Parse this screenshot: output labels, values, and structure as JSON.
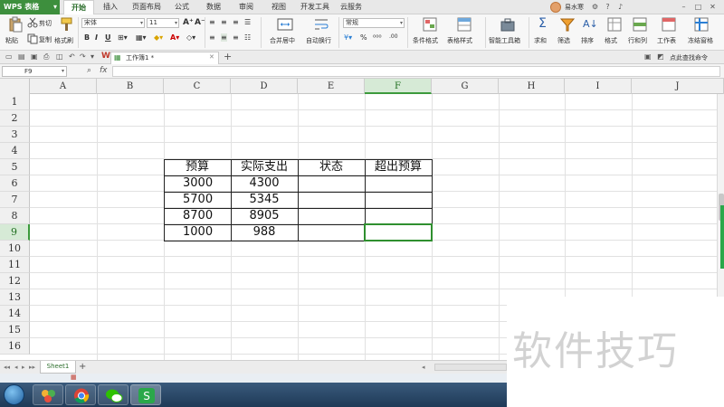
{
  "menubar": {
    "app_label": "WPS 表格",
    "tabs": [
      "开始",
      "插入",
      "页面布局",
      "公式",
      "数据",
      "审阅",
      "视图",
      "开发工具",
      "云服务"
    ],
    "active_tab": "开始",
    "user_name": "易水寒"
  },
  "ribbon": {
    "cut": "剪切",
    "paste": "粘贴",
    "copy": "复制",
    "format_painter": "格式刷",
    "font_name": "宋体",
    "font_size": "11",
    "number_format": "常规",
    "merge_center": "合并居中",
    "wrap_text": "自动换行",
    "conditional_format": "条件格式",
    "table_style": "表格样式",
    "smart_toolbox": "智能工具箱",
    "sum": "求和",
    "filter": "筛选",
    "sort": "排序",
    "format": "格式",
    "row_col": "行和列",
    "worksheet": "工作表",
    "freeze": "冻结窗格",
    "percent": "%"
  },
  "tabbar": {
    "doc_title": "工作簿1 *"
  },
  "formula": {
    "name_box": "F9",
    "fx": "fx",
    "command_search": "点此查找命令"
  },
  "grid": {
    "columns": [
      "A",
      "B",
      "C",
      "D",
      "E",
      "F",
      "G",
      "H",
      "I",
      "J"
    ],
    "rows": [
      "1",
      "2",
      "3",
      "4",
      "5",
      "6",
      "7",
      "8",
      "9",
      "10",
      "11",
      "12",
      "13",
      "14",
      "15",
      "16"
    ],
    "selected_col": "F",
    "selected_row": "9"
  },
  "table": {
    "headers": [
      "预算",
      "实际支出",
      "状态",
      "超出预算"
    ],
    "rows": [
      [
        "3000",
        "4300",
        "",
        ""
      ],
      [
        "5700",
        "5345",
        "",
        ""
      ],
      [
        "8700",
        "8905",
        "",
        ""
      ],
      [
        "1000",
        "988",
        "",
        ""
      ]
    ]
  },
  "sheets": {
    "tabs": [
      "Sheet1"
    ],
    "add": "+"
  },
  "watermark": {
    "text": "软件技巧"
  },
  "colors": {
    "accent_green": "#2f8f2f",
    "header_selected": "#d6ead6",
    "app_button": "#3d8f3d"
  }
}
